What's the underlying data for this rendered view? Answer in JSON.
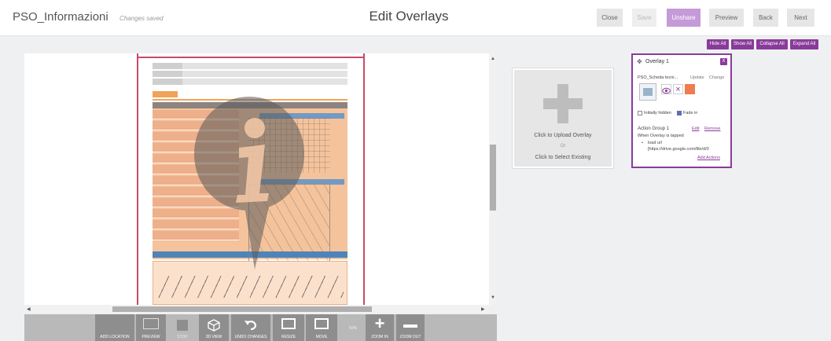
{
  "header": {
    "app_title": "PSO_Informazioni",
    "save_status": "Changes saved",
    "page_title": "Edit Overlays",
    "buttons": {
      "close": "Close",
      "save": "Save",
      "unshare": "Unshare",
      "preview": "Preview",
      "back": "Back",
      "next": "Next"
    }
  },
  "overlay_toolbar": {
    "hide_all": "Hide All",
    "show_all": "Show All",
    "collapse_all": "Collapse All",
    "expand_all": "Expand All"
  },
  "bottom_toolbar": {
    "add_location": "ADD LOCATION",
    "preview": "PREVIEW",
    "stop": "STOP",
    "view_3d": "3D VIEW",
    "undo_changes": "UNDO CHANGES",
    "resize": "RESIZE",
    "move": "MOVE",
    "zoom_level": "50%",
    "zoom_in": "ZOOM IN",
    "zoom_out": "ZOOM OUT"
  },
  "upload_panel": {
    "upload": "Click to Upload Overlay",
    "or": "Or",
    "select_existing": "Click to Select Existing"
  },
  "overlay_card": {
    "title": "Overlay 1",
    "close_label": "X",
    "file_name": "PSO_Scheda tecni...",
    "update": "Update",
    "change": "Change",
    "initially_hidden": "Initially hidden",
    "initially_hidden_checked": false,
    "fade_in": "Fade in",
    "fade_in_checked": true,
    "action_group": "Action Group 1",
    "edit": "Edit",
    "remove": "Remove",
    "trigger": "When Overlay is tapped",
    "action": "load url",
    "url": "[https://drive.google.com/file/d/0",
    "add_actions": "Add Actions",
    "overlay_color": "#f07b4e"
  },
  "colors": {
    "accent": "#8a3b9a",
    "accent_light": "#c59ad8"
  }
}
